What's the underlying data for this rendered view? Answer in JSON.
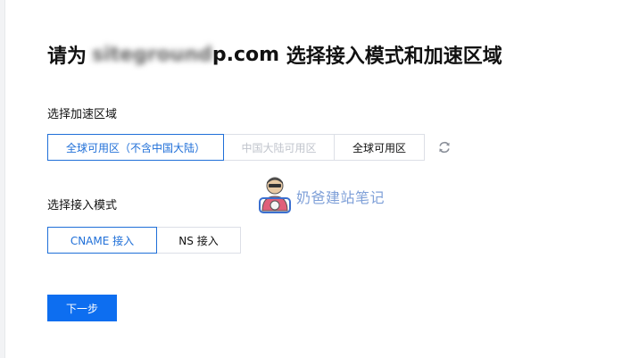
{
  "header": {
    "title_prefix": "请为",
    "domain_blurred": "siteground",
    "domain_tail": "p.com",
    "title_suffix": "选择接入模式和加速区域"
  },
  "region": {
    "label": "选择加速区域",
    "options": [
      {
        "label": "全球可用区（不含中国大陆）",
        "state": "selected"
      },
      {
        "label": "中国大陆可用区",
        "state": "disabled"
      },
      {
        "label": "全球可用区",
        "state": "normal"
      }
    ],
    "refresh_icon": "refresh-icon"
  },
  "mode": {
    "label": "选择接入模式",
    "options": [
      {
        "label": "CNAME 接入",
        "state": "selected"
      },
      {
        "label": "NS 接入",
        "state": "normal"
      }
    ]
  },
  "watermark": {
    "text": "奶爸建站笔记",
    "icon": "avatar-icon"
  },
  "actions": {
    "next_label": "下一步"
  },
  "colors": {
    "accent": "#1f6fd8",
    "primary_button": "#0d6ef0",
    "disabled_text": "#c0c4cc",
    "border": "#dcdfe6",
    "watermark_text": "#7fa0d8"
  }
}
